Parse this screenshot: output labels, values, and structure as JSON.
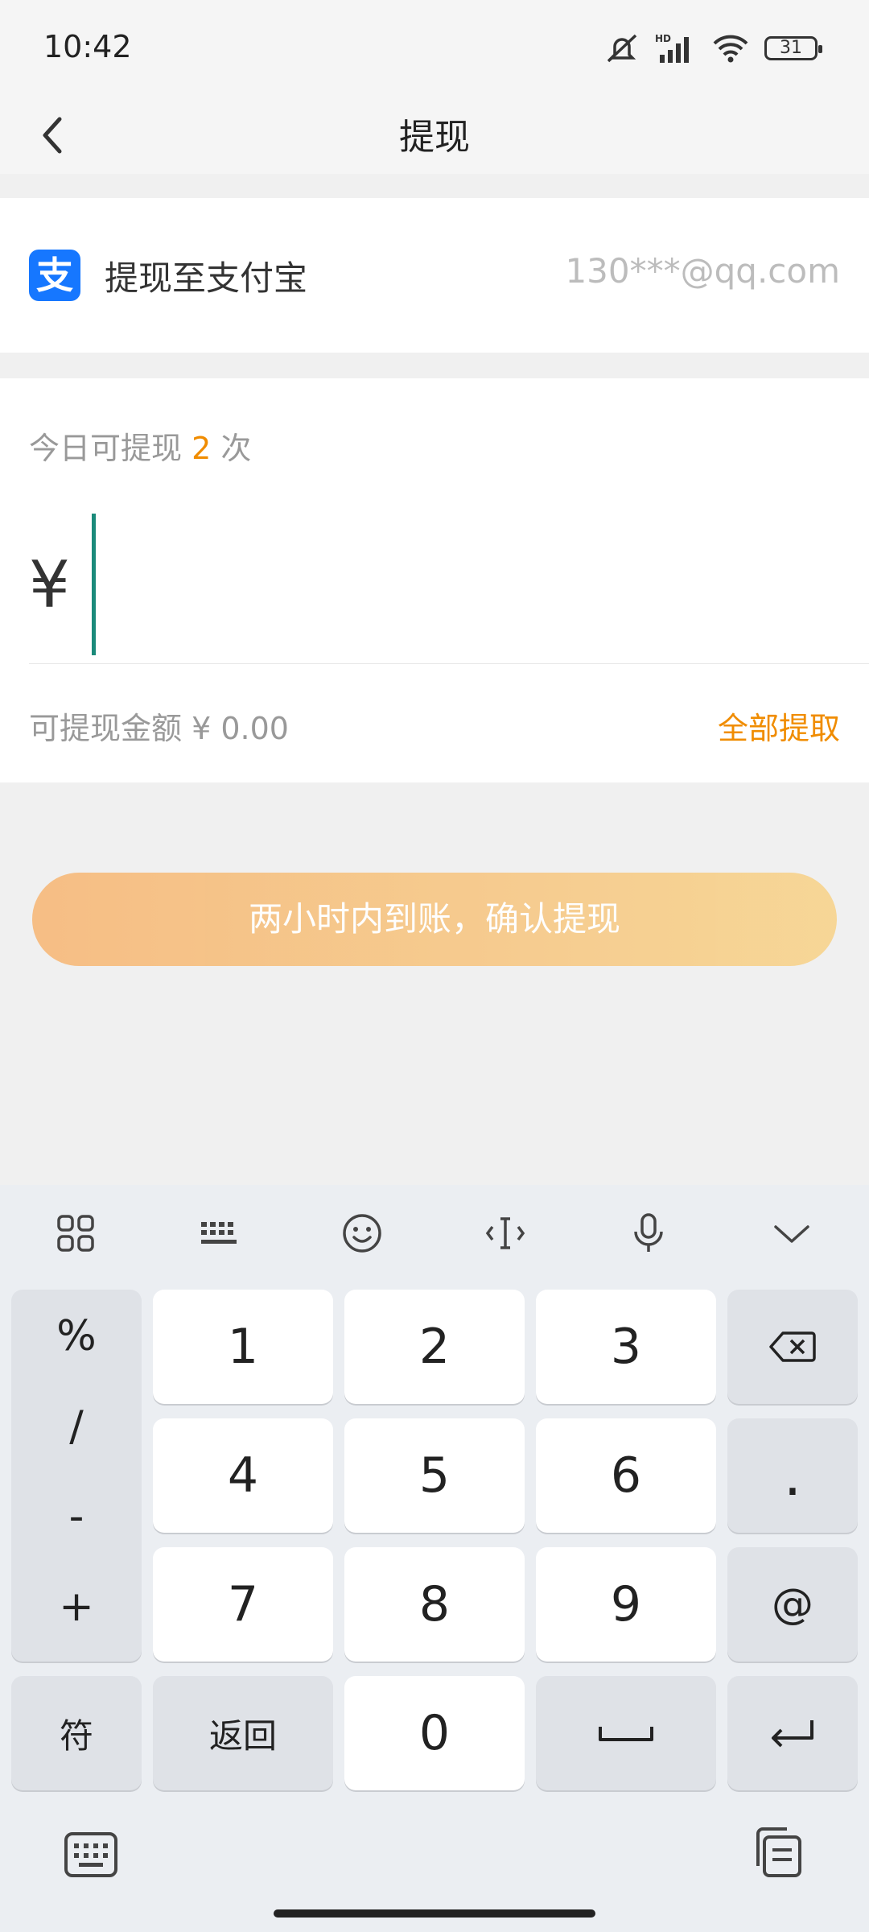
{
  "status_bar": {
    "time": "10:42",
    "battery": "31"
  },
  "header": {
    "title": "提现"
  },
  "account": {
    "label": "提现至支付宝",
    "value": "130***@qq.com",
    "logo_glyph": "支"
  },
  "amount": {
    "times_prefix": "今日可提现",
    "times_count": "2",
    "times_suffix": "次",
    "currency": "¥",
    "available_label": "可提现金额 ¥ 0.00",
    "withdraw_all": "全部提取"
  },
  "confirm_button": {
    "label": "两小时内到账，确认提现"
  },
  "keyboard": {
    "symbols": [
      "%",
      "/",
      "-",
      "+"
    ],
    "digits": [
      "1",
      "2",
      "3",
      "4",
      "5",
      "6",
      "7",
      "8",
      "9",
      "0"
    ],
    "dot": ".",
    "at": "@",
    "sym_key": "符",
    "back_key": "返回"
  },
  "colors": {
    "accent": "#f08c00",
    "alipay": "#1677ff",
    "cursor": "#1a8a7a"
  },
  "icons": [
    "back-icon",
    "mute-icon",
    "signal-icon",
    "wifi-icon",
    "battery-icon",
    "grid-icon",
    "keyboard-icon",
    "emoji-icon",
    "text-cursor-icon",
    "mic-icon",
    "chevron-down-icon",
    "backspace-icon",
    "space-icon",
    "enter-icon",
    "clipboard-icon"
  ]
}
